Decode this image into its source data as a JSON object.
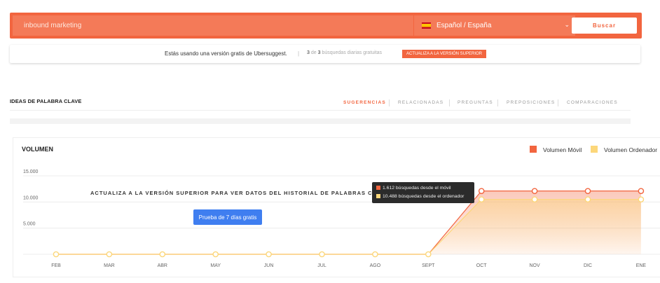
{
  "search": {
    "keyword_value": "inbound marketing",
    "language": "Español / España",
    "language_flag_icon": "spain-flag-icon",
    "dropdown_icon": "chevron-down-icon",
    "button_label": "Buscar",
    "accent_color": "#f2653f"
  },
  "notice": {
    "text": "Estás usando una versión gratis de Ubersuggest.",
    "separator": "|",
    "used": "3",
    "count_mid": " de ",
    "total": "3",
    "count_suffix": " búsquedas diarias gratuitas",
    "upgrade_label": "ACTUALIZA A LA VERSIÓN SUPERIOR"
  },
  "ideas": {
    "title": "IDEAS DE PALABRA CLAVE",
    "tabs": [
      {
        "label": "SUGERENCIAS",
        "active": true
      },
      {
        "label": "RELACIONADAS",
        "active": false
      },
      {
        "label": "PREGUNTAS",
        "active": false
      },
      {
        "label": "PREPOSICIONES",
        "active": false
      },
      {
        "label": "COMPARACIONES",
        "active": false
      }
    ]
  },
  "volume_chart": {
    "title": "VOLUMEN",
    "overlay_text": "ACTUALIZA A LA VERSIÓN SUPERIOR PARA VER DATOS DEL HISTORIAL DE PALABRAS CLAVE",
    "trial_button": "Prueba de 7 días gratis",
    "tooltip": {
      "mobile": "1.612 búsquedas desde el móvil",
      "desktop": "10.488 búsquedas desde el ordenador"
    }
  },
  "chart_data": {
    "type": "area",
    "categories": [
      "FEB",
      "MAR",
      "ABR",
      "MAY",
      "JUN",
      "JUL",
      "AGO",
      "SEPT",
      "OCT",
      "NOV",
      "DIC",
      "ENE"
    ],
    "series": [
      {
        "name": "Volumen Móvil",
        "color": "#f2653f",
        "values": [
          0,
          0,
          0,
          0,
          0,
          0,
          0,
          0,
          12100,
          12100,
          12100,
          12100
        ]
      },
      {
        "name": "Volumen Ordenador",
        "color": "#fcd77a",
        "values": [
          0,
          0,
          0,
          0,
          0,
          0,
          0,
          0,
          10488,
          10488,
          10488,
          10488
        ]
      }
    ],
    "yticks": [
      15000,
      10000,
      5000
    ],
    "ytick_labels": [
      "15.000",
      "10.000",
      "5.000"
    ],
    "ylim": [
      0,
      15000
    ],
    "grid": true,
    "legend_position": "top-right"
  }
}
